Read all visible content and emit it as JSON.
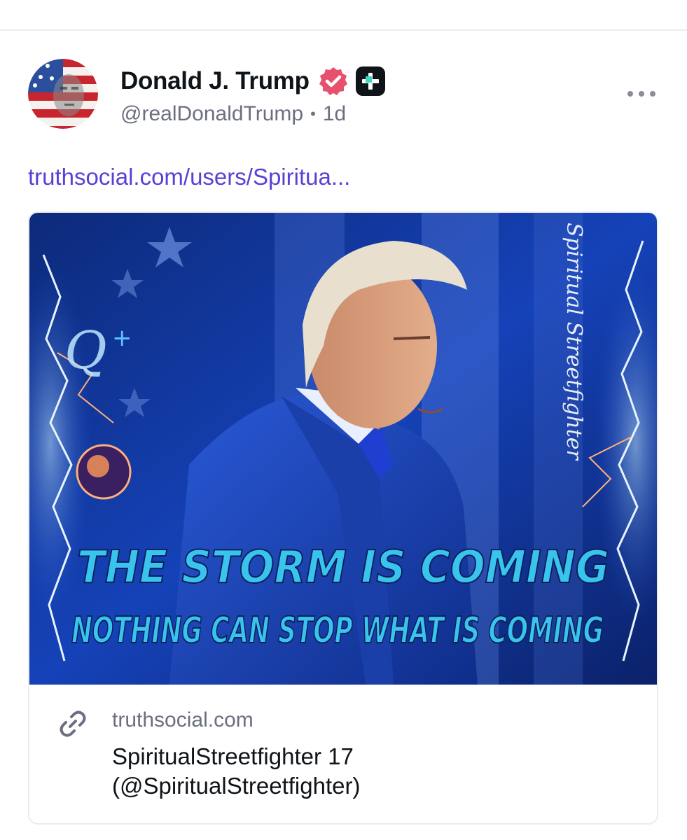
{
  "post": {
    "author_name": "Donald J. Trump",
    "handle": "@realDonaldTrump",
    "separator": "•",
    "time_ago": "1d",
    "link_text": "truthsocial.com/users/Spiritua..."
  },
  "link_card": {
    "image_text": {
      "watermark": "Spiritual Streetfighter",
      "q_mark": "Q",
      "q_plus": "+",
      "headline": "THE STORM IS COMING",
      "subheadline": "NOTHING CAN STOP WHAT IS COMING"
    },
    "domain": "truthsocial.com",
    "title_line1": "SpiritualStreetfighter 17",
    "title_line2": "(@SpiritualStreetfighter)"
  },
  "icons": {
    "verified": "verified-badge-icon",
    "plus": "truth-plus-icon",
    "more": "more-options-icon",
    "link": "link-icon"
  },
  "colors": {
    "link": "#5b3fd6",
    "verified": "#e8516d",
    "secondary_text": "#6b6f80",
    "image_text": "#39c3ef"
  }
}
